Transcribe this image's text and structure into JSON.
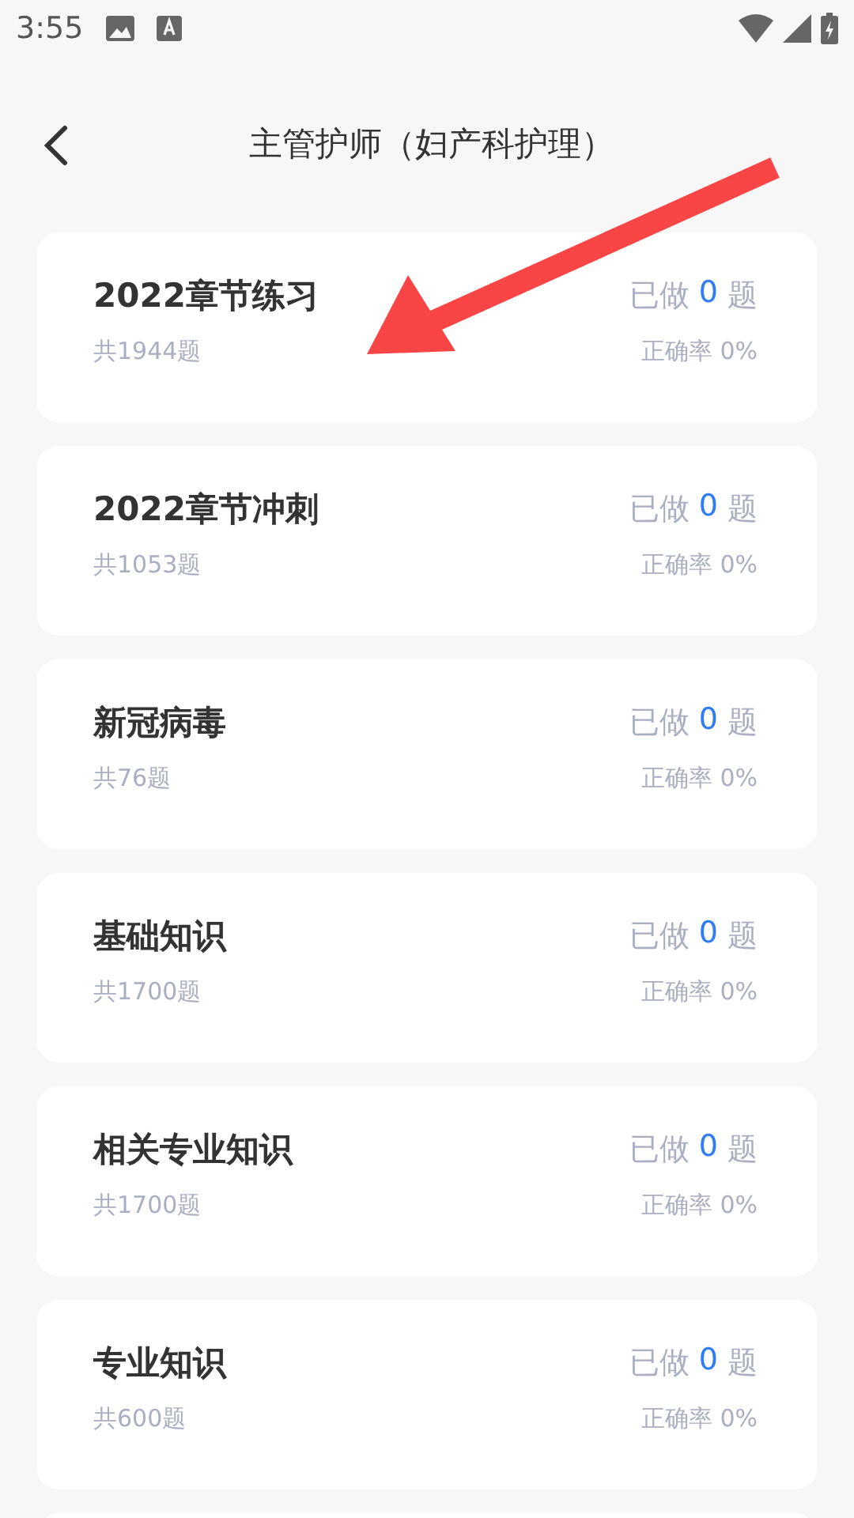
{
  "status_bar": {
    "time": "3:55"
  },
  "header": {
    "title": "主管护师（妇产科护理）"
  },
  "cards": [
    {
      "title": "2022章节练习",
      "total": "共1944题",
      "done_label": "已做",
      "done_count": "0",
      "done_unit": "题",
      "accuracy": "正确率 0%"
    },
    {
      "title": "2022章节冲刺",
      "total": "共1053题",
      "done_label": "已做",
      "done_count": "0",
      "done_unit": "题",
      "accuracy": "正确率 0%"
    },
    {
      "title": "新冠病毒",
      "total": "共76题",
      "done_label": "已做",
      "done_count": "0",
      "done_unit": "题",
      "accuracy": "正确率 0%"
    },
    {
      "title": "基础知识",
      "total": "共1700题",
      "done_label": "已做",
      "done_count": "0",
      "done_unit": "题",
      "accuracy": "正确率 0%"
    },
    {
      "title": "相关专业知识",
      "total": "共1700题",
      "done_label": "已做",
      "done_count": "0",
      "done_unit": "题",
      "accuracy": "正确率 0%"
    },
    {
      "title": "专业知识",
      "total": "共600题",
      "done_label": "已做",
      "done_count": "0",
      "done_unit": "题",
      "accuracy": "正确率 0%"
    }
  ]
}
